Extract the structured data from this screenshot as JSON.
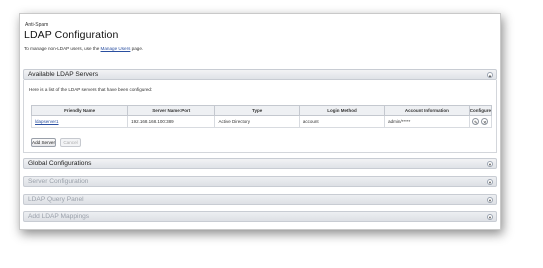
{
  "breadcrumb": "Anti-Spam",
  "page_title": "LDAP Configuration",
  "intro": {
    "prefix": "To manage non-LDAP users, use the ",
    "link": "Manage Users",
    "suffix": " page."
  },
  "available_servers": {
    "title": "Available LDAP Servers",
    "note": "Here is a list of the LDAP servers that have been configured:",
    "columns": [
      "Friendly Name",
      "Server Name:Port",
      "Type",
      "Login Method",
      "Account Information",
      "Configure"
    ],
    "rows": [
      {
        "friendly_name": "ldapserver1",
        "server_port": "192.168.168.100:389",
        "type": "Active Directory",
        "login_method": "account",
        "account_info": "admin/*****"
      }
    ],
    "add_server_label": "Add Server",
    "cancel_label": "Cancel"
  },
  "sections": [
    {
      "title": "Global Configurations",
      "enabled": true
    },
    {
      "title": "Server Configuration",
      "enabled": false
    },
    {
      "title": "LDAP Query Panel",
      "enabled": false
    },
    {
      "title": "Add LDAP Mappings",
      "enabled": false
    }
  ],
  "icons": {
    "toggle": "expand-toggle-icon",
    "edit": "pencil-icon",
    "delete": "close-icon"
  },
  "colors": {
    "link": "#2a4fa0",
    "panel_header": "#dfe2e7",
    "disabled_text": "#9aa0aa"
  }
}
